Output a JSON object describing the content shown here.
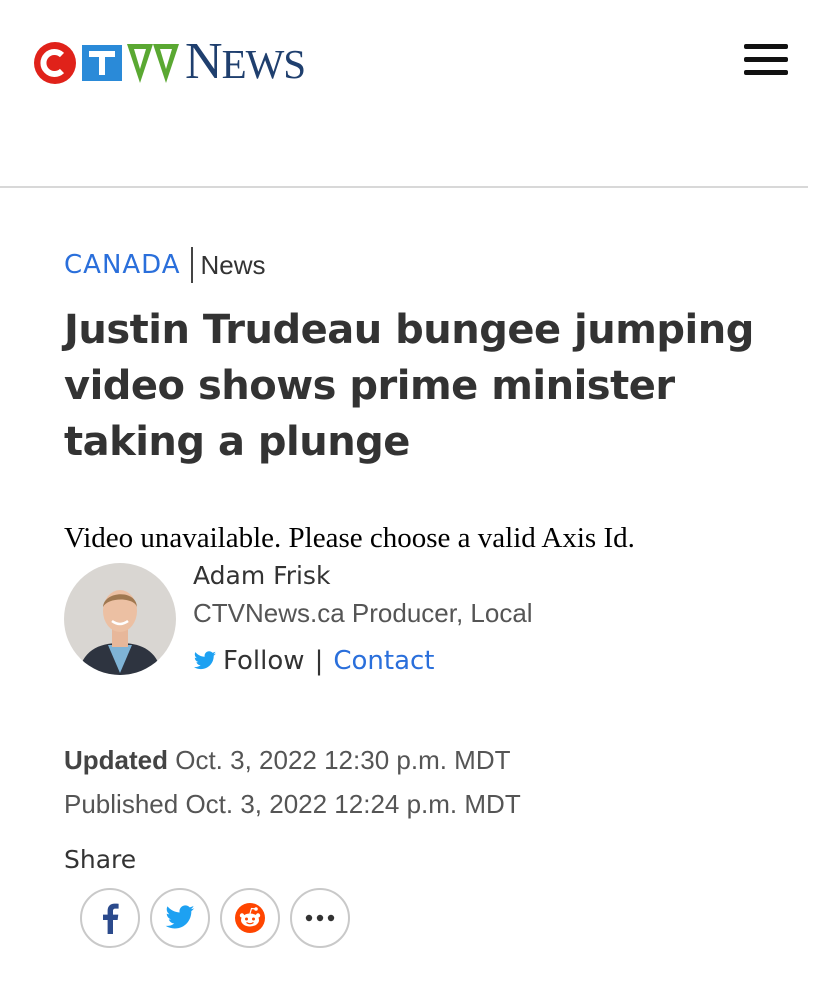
{
  "header": {
    "logo_text": "CTV",
    "news_first": "N",
    "news_rest": "EWS",
    "colors": {
      "c_red": "#e0221a",
      "t_blue": "#2a8ad8",
      "v_green": "#5aa832",
      "news_navy": "#1f3f6e"
    },
    "menu_icon": "hamburger-menu-icon"
  },
  "breadcrumb": {
    "section": "CANADA",
    "subsection": "News"
  },
  "article": {
    "headline": "Justin Trudeau bungee jumping video shows prime minister taking a plunge",
    "video_message": "Video unavailable. Please choose a valid Axis Id."
  },
  "author": {
    "name": "Adam Frisk",
    "role": "CTVNews.ca Producer, Local",
    "follow_label": "Follow",
    "separator": "|",
    "contact_label": "Contact"
  },
  "meta": {
    "updated_label": "Updated",
    "updated_value": "Oct. 3, 2022 12:30 p.m. MDT",
    "published_label": "Published",
    "published_value": "Oct. 3, 2022 12:24 p.m. MDT"
  },
  "share": {
    "label": "Share",
    "buttons": [
      "facebook-icon",
      "twitter-icon",
      "reddit-icon",
      "more-icon"
    ]
  },
  "accent_color": "#2a6fdb"
}
